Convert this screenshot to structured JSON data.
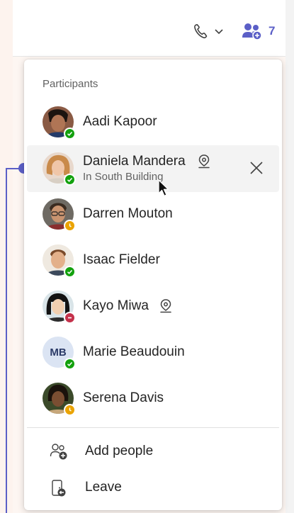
{
  "header": {
    "call_icon": "phone-icon",
    "chevron_icon": "chevron-down-icon",
    "people_icon": "people-add-icon",
    "people_count": "7",
    "accent_color": "#5b5fc7"
  },
  "panel": {
    "title": "Participants",
    "participants": [
      {
        "name": "Aadi Kapoor",
        "status": "available",
        "subtitle": ""
      },
      {
        "name": "Daniela Mandera",
        "status": "available",
        "subtitle": "In South Building",
        "location_icon": "location-pin-icon"
      },
      {
        "name": "Darren Mouton",
        "status": "away",
        "subtitle": ""
      },
      {
        "name": "Isaac Fielder",
        "status": "available",
        "subtitle": ""
      },
      {
        "name": "Kayo Miwa",
        "status": "busy",
        "subtitle": "",
        "location_icon": "location-pin-icon"
      },
      {
        "name": "Marie Beaudouin",
        "status": "available",
        "subtitle": "",
        "initials": "MB"
      },
      {
        "name": "Serena Davis",
        "status": "away",
        "subtitle": ""
      }
    ],
    "actions": [
      {
        "label": "Add people",
        "icon": "add-people-icon"
      },
      {
        "label": "Leave",
        "icon": "leave-icon"
      }
    ]
  },
  "status_colors": {
    "available": "#13a10e",
    "away": "#eaa300",
    "busy": "#c4314b"
  }
}
